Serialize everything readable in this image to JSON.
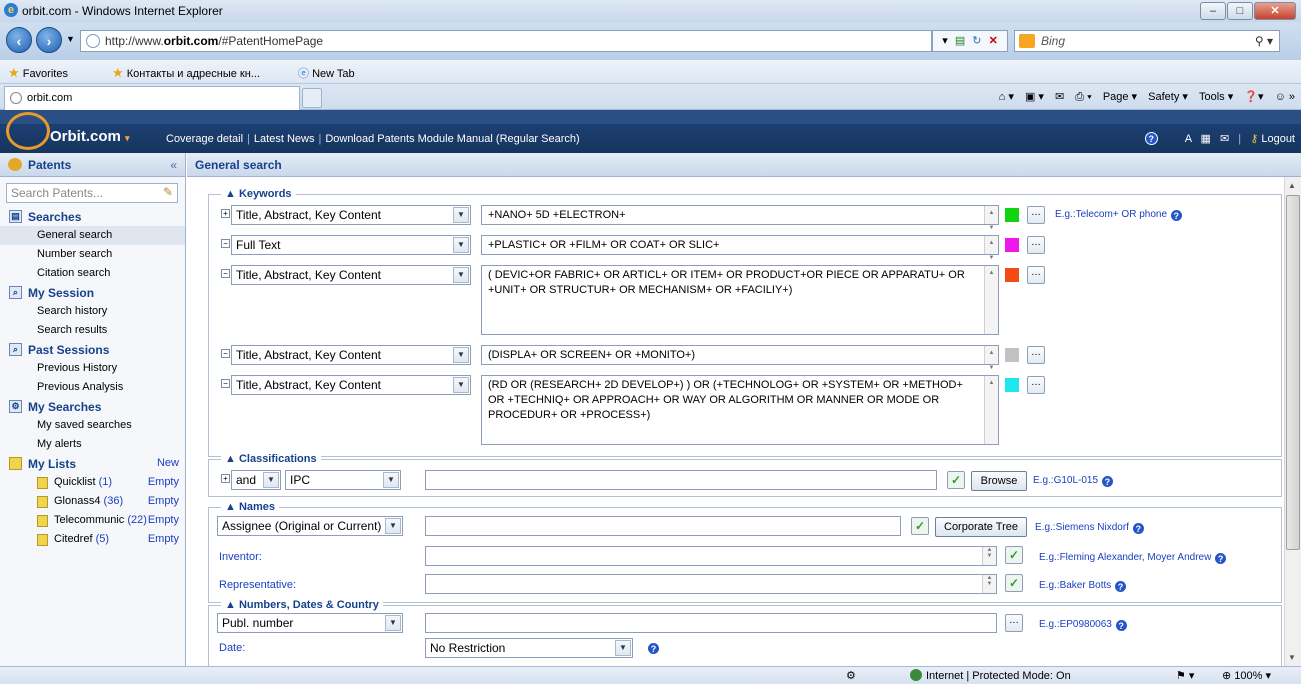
{
  "browser": {
    "window_title": "orbit.com - Windows Internet Explorer",
    "url_prefix": "http://www.",
    "url_host": "orbit.com",
    "url_path": "/#PatentHomePage",
    "search_engine": "Bing",
    "favorites_label": "Favorites",
    "fav_item1": "Контакты и адресные кн...",
    "fav_item2": "New Tab",
    "active_tab": "orbit.com",
    "cmd_page": "Page ▾",
    "cmd_safety": "Safety ▾",
    "cmd_tools": "Tools ▾",
    "status_zone": "Internet | Protected Mode: On",
    "zoom": "100%"
  },
  "header": {
    "brand": "Orbit.com",
    "links": [
      "Coverage detail",
      "Latest News",
      "Download Patents Module Manual (Regular Search)"
    ],
    "logout": "Logout"
  },
  "sidebar": {
    "title": "Patents",
    "search_placeholder": "Search Patents...",
    "searches_title": "Searches",
    "searches_items": [
      "General search",
      "Number search",
      "Citation search"
    ],
    "session_title": "My Session",
    "session_items": [
      "Search history",
      "Search results"
    ],
    "past_title": "Past Sessions",
    "past_items": [
      "Previous History",
      "Previous Analysis"
    ],
    "mysearch_title": "My Searches",
    "mysearch_items": [
      "My saved searches",
      "My alerts"
    ],
    "lists_title": "My Lists",
    "lists_new": "New",
    "lists": [
      {
        "name": "Quicklist",
        "count": "(1)",
        "action": "Empty"
      },
      {
        "name": "Glonass4",
        "count": "(36)",
        "action": "Empty"
      },
      {
        "name": "Telecommunic",
        "count": "(22)",
        "action": "Empty"
      },
      {
        "name": "Citedref",
        "count": "(5)",
        "action": "Empty"
      }
    ]
  },
  "main": {
    "title": "General search",
    "keywords": {
      "legend": "Keywords",
      "rows": [
        {
          "field": "Title, Abstract, Key Content",
          "query": "+NANO+ 5D +ELECTRON+",
          "color": "#12d312",
          "example": "E.g.:Telecom+ OR phone"
        },
        {
          "field": "Full Text",
          "query": "+PLASTIC+ OR +FILM+ OR COAT+ OR SLIC+",
          "color": "#ee17e8"
        },
        {
          "field": "Title, Abstract, Key Content",
          "query": "( DEVIC+OR FABRIC+ OR ARTICL+ OR ITEM+ OR PRODUCT+OR PIECE OR APPARATU+ OR +UNIT+ OR STRUCTUR+ OR MECHANISM+ OR +FACILIY+)",
          "color": "#f24b16"
        },
        {
          "field": "Title, Abstract, Key Content",
          "query": "(DISPLA+ OR SCREEN+ OR +MONITO+)",
          "color": "#c2c2c2"
        },
        {
          "field": "Title, Abstract, Key Content",
          "query": "(RD OR (RESEARCH+ 2D DEVELOP+) ) OR (+TECHNOLOG+ OR +SYSTEM+ OR +METHOD+ OR +TECHNIQ+ OR APPROACH+ OR WAY OR ALGORITHM OR MANNER OR MODE OR PROCEDUR+ OR +PROCESS+)",
          "color": "#1ee6ee"
        }
      ]
    },
    "classifications": {
      "legend": "Classifications",
      "operator": "and",
      "scheme": "IPC",
      "browse": "Browse",
      "example": "E.g.:G10L-015"
    },
    "names": {
      "legend": "Names",
      "assignee_field": "Assignee (Original or Current)",
      "corporate_tree": "Corporate Tree",
      "assignee_example": "E.g.:Siemens Nixdorf",
      "inventor_label": "Inventor:",
      "inventor_example": "E.g.:Fleming Alexander, Moyer Andrew",
      "representative_label": "Representative:",
      "representative_example": "E.g.:Baker Botts"
    },
    "numbers": {
      "legend": "Numbers, Dates & Country",
      "number_field": "Publ. number",
      "number_example": "E.g.:EP0980063",
      "date_label": "Date:",
      "date_value": "No Restriction"
    }
  }
}
